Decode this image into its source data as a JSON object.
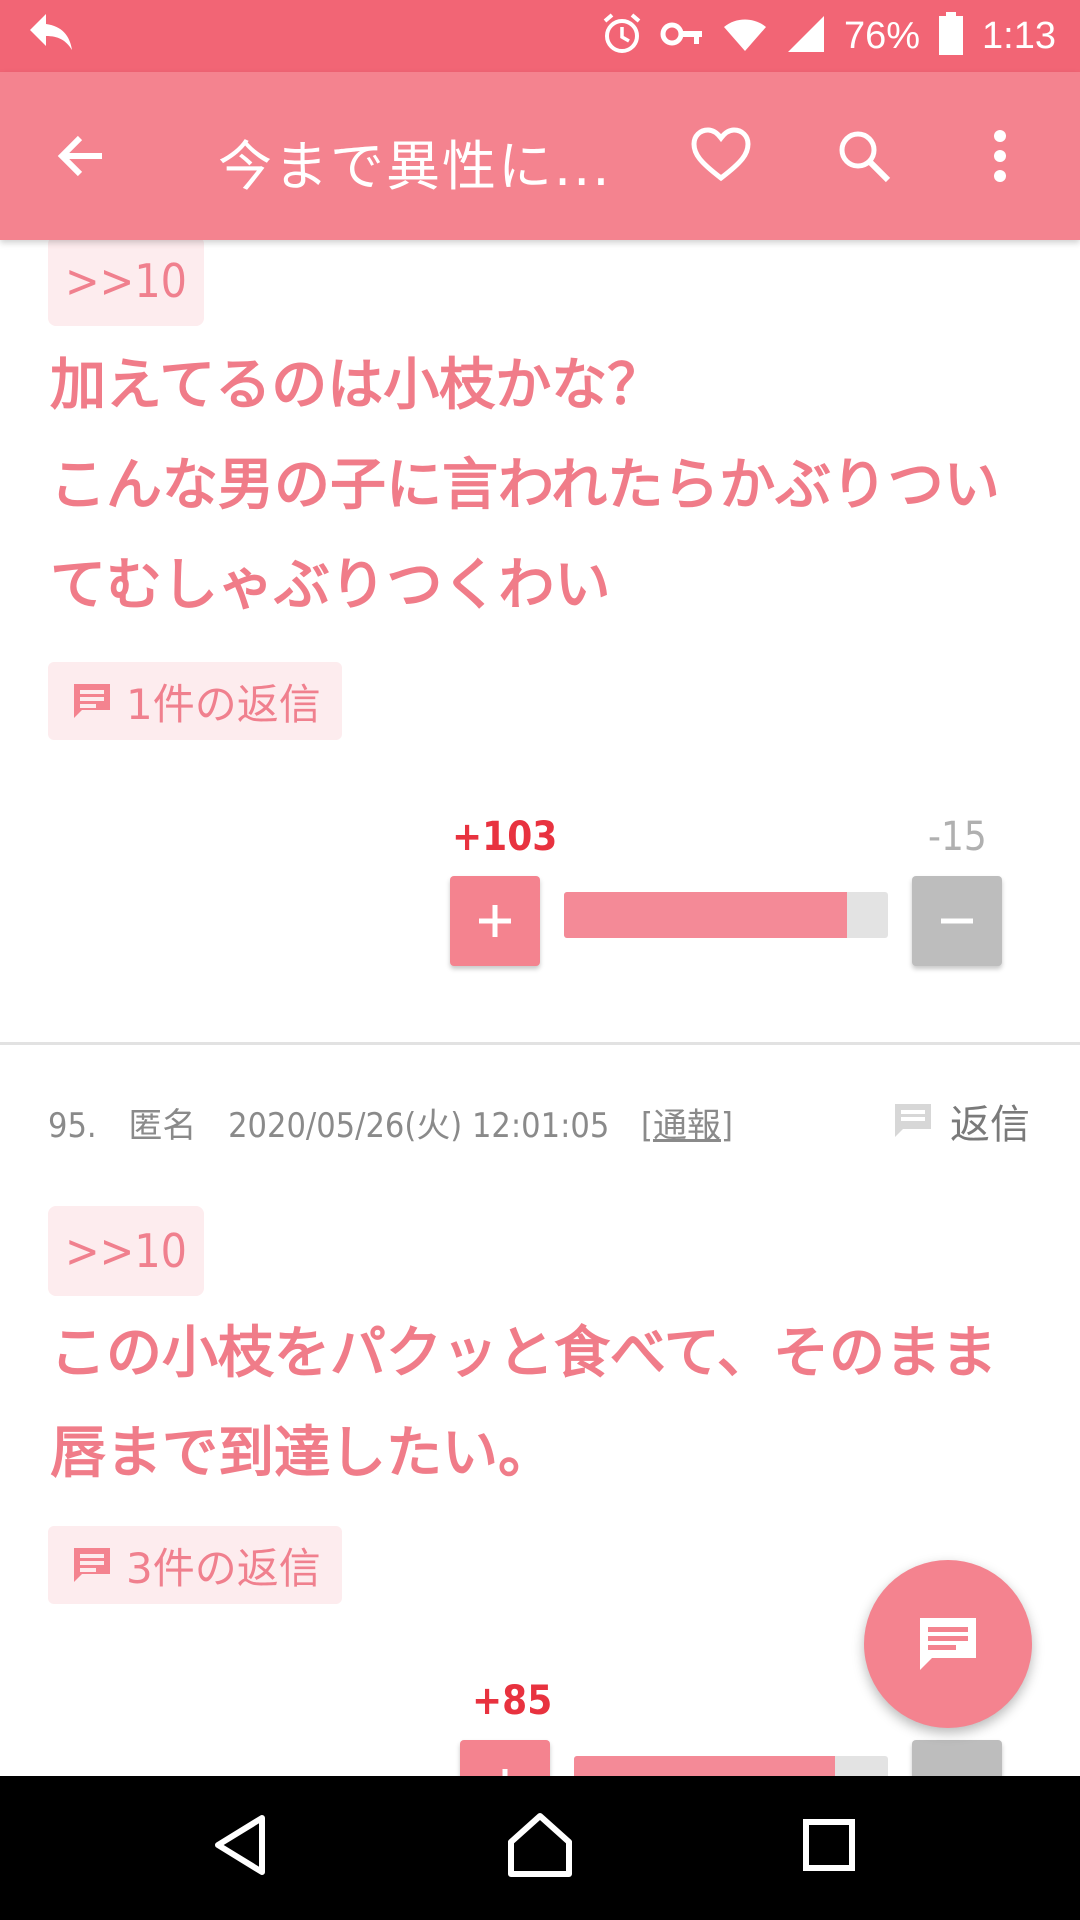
{
  "status_bar": {
    "battery": "76%",
    "time": "1:13"
  },
  "app_bar": {
    "title": "今まで異性に..."
  },
  "comment1": {
    "anchor": ">>10",
    "text": "加えてるのは小枝かな？\nこんな男の子に言われたらかぶりついてむしゃぶりつくわい",
    "reply_count": "1件の返信",
    "plus_count": "+103",
    "minus_count": "-15",
    "plus_ratio": 0.8729
  },
  "comment2": {
    "number": "95.",
    "author": "匿名",
    "datetime": "2020/05/26(火) 12:01:05",
    "report_open": "[",
    "report_label": "通報",
    "report_close": "]",
    "reply_label": "返信",
    "anchor": ">>10",
    "text": "この小枝をパクッと食べて、そのまま唇まで到達したい。",
    "reply_count": "3件の返信",
    "plus_count": "+85",
    "plus_ratio": 0.83
  },
  "colors": {
    "status_bar": "#f26575",
    "app_bar": "#f4838f",
    "body_text": "#f07c89",
    "plus_count": "#e8323f"
  }
}
